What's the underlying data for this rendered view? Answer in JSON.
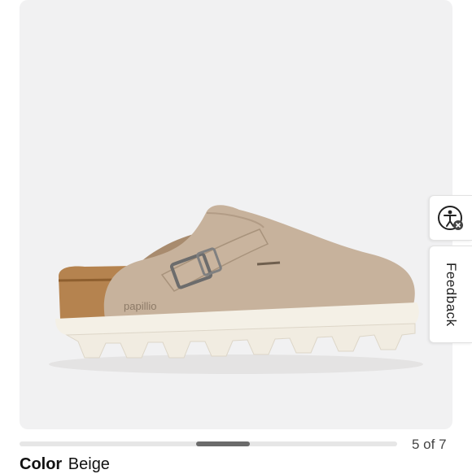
{
  "product": {
    "image_alt_name": "beige suede clog with white chunky sole",
    "brand_emboss": "papillio"
  },
  "widgets": {
    "accessibility_icon": "accessibility-person-icon",
    "feedback_label": "Feedback"
  },
  "carousel": {
    "current": 5,
    "total": 7,
    "counter_text": "5 of 7",
    "progress_fraction": 0.71
  },
  "color": {
    "label": "Color",
    "value": "Beige"
  },
  "colors": {
    "panel_background": "#f1f1f2",
    "suede": "#c7b29c",
    "sole": "#f4f0e6",
    "cork": "#b5834f"
  }
}
